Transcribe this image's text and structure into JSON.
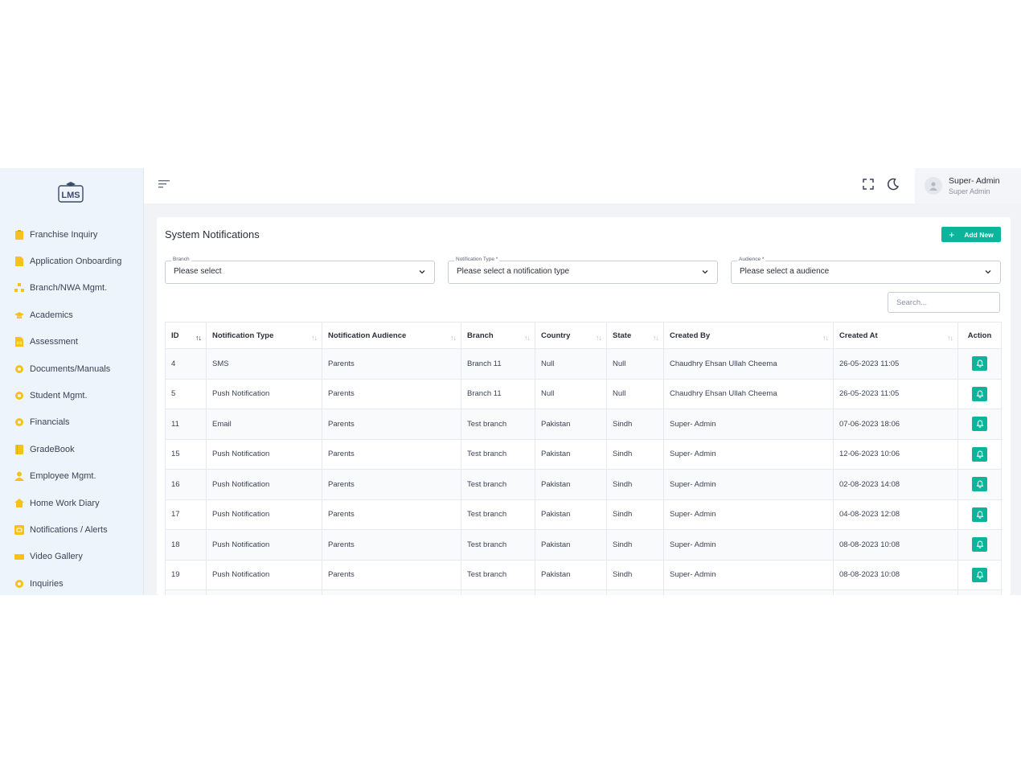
{
  "app": {
    "logo_text": "LMS"
  },
  "sidebar": {
    "items": [
      {
        "label": "Franchise Inquiry",
        "icon": "clipboard-icon"
      },
      {
        "label": "Application Onboarding",
        "icon": "file-icon"
      },
      {
        "label": "Branch/NWA Mgmt.",
        "icon": "sitemap-icon"
      },
      {
        "label": "Academics",
        "icon": "graduation-cap-icon"
      },
      {
        "label": "Assessment",
        "icon": "file-text-icon"
      },
      {
        "label": "Documents/Manuals",
        "icon": "gear-icon"
      },
      {
        "label": "Student Mgmt.",
        "icon": "gear-icon"
      },
      {
        "label": "Financials",
        "icon": "gear-icon"
      },
      {
        "label": "GradeBook",
        "icon": "book-icon"
      },
      {
        "label": "Employee Mgmt.",
        "icon": "user-icon"
      },
      {
        "label": "Home Work Diary",
        "icon": "home-icon"
      },
      {
        "label": "Notifications / Alerts",
        "icon": "alert-square-icon"
      },
      {
        "label": "Video Gallery",
        "icon": "video-icon"
      },
      {
        "label": "Inquiries",
        "icon": "gear-icon"
      }
    ]
  },
  "topbar": {
    "user_name": "Super- Admin",
    "user_role": "Super Admin"
  },
  "page": {
    "title": "System Notifications",
    "add_label": "Add New",
    "filters": [
      {
        "label": "Branch",
        "value": "Please select"
      },
      {
        "label": "Notification Type *",
        "value": "Please select a notification type"
      },
      {
        "label": "Audience *",
        "value": "Please select a audience"
      }
    ],
    "search_placeholder": "Search..."
  },
  "table": {
    "headers": [
      "ID",
      "Notification Type",
      "Notification Audience",
      "Branch",
      "Country",
      "State",
      "Created By",
      "Created At",
      "Action"
    ],
    "rows": [
      [
        "4",
        "SMS",
        "Parents",
        "Branch 11",
        "Null",
        "Null",
        "Chaudhry Ehsan Ullah Cheema",
        "26-05-2023 11:05"
      ],
      [
        "5",
        "Push Notification",
        "Parents",
        "Branch 11",
        "Null",
        "Null",
        "Chaudhry Ehsan Ullah Cheema",
        "26-05-2023 11:05"
      ],
      [
        "11",
        "Email",
        "Parents",
        "Test branch",
        "Pakistan",
        "Sindh",
        "Super- Admin",
        "07-06-2023 18:06"
      ],
      [
        "15",
        "Push Notification",
        "Parents",
        "Test branch",
        "Pakistan",
        "Sindh",
        "Super- Admin",
        "12-06-2023 10:06"
      ],
      [
        "16",
        "Push Notification",
        "Parents",
        "Test branch",
        "Pakistan",
        "Sindh",
        "Super- Admin",
        "02-08-2023 14:08"
      ],
      [
        "17",
        "Push Notification",
        "Parents",
        "Test branch",
        "Pakistan",
        "Sindh",
        "Super- Admin",
        "04-08-2023 12:08"
      ],
      [
        "18",
        "Push Notification",
        "Parents",
        "Test branch",
        "Pakistan",
        "Sindh",
        "Super- Admin",
        "08-08-2023 10:08"
      ],
      [
        "19",
        "Push Notification",
        "Parents",
        "Test branch",
        "Pakistan",
        "Sindh",
        "Super- Admin",
        "08-08-2023 10:08"
      ],
      [
        "",
        "",
        "",
        "",
        "",
        "",
        "",
        ""
      ]
    ]
  },
  "colors": {
    "accent": "#0bb59b",
    "sidebar_bg": "#eef4fb",
    "icon_yellow": "#f4c21a"
  }
}
